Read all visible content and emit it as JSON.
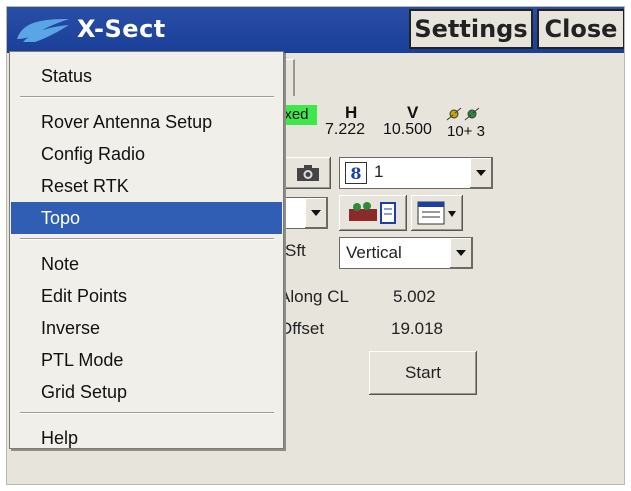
{
  "app": {
    "title": "X-Sect",
    "settings_label": "Settings",
    "close_label": "Close"
  },
  "status": {
    "fix_label": "ixed",
    "fix_color": "#3fe84a",
    "h_label": "H",
    "h_value": "7.222",
    "v_label": "V",
    "v_value": "10.500",
    "sats": "10+ 3"
  },
  "controls": {
    "point_value": "1",
    "sft_label": "Sft",
    "vertical_value": "Vertical",
    "along_cl_label": "Along CL",
    "along_cl_value": "5.002",
    "offset_label": "Offset",
    "offset_value": "19.018",
    "start_label": "Start"
  },
  "menu": {
    "groups": [
      [
        "Status"
      ],
      [
        "Rover Antenna Setup",
        "Config Radio",
        "Reset RTK",
        "Topo"
      ],
      [
        "Note",
        "Edit Points",
        "Inverse",
        "PTL Mode",
        "Grid Setup"
      ],
      [
        "Help"
      ]
    ],
    "selected": "Topo",
    "selected_color": "#2f5eb4"
  },
  "icons": {
    "logo": "ashtech-logo-icon",
    "satellite": "satellite-icon",
    "camera": "camera-icon",
    "point": "point-icon",
    "map": "map-icon",
    "list": "list-icon"
  }
}
